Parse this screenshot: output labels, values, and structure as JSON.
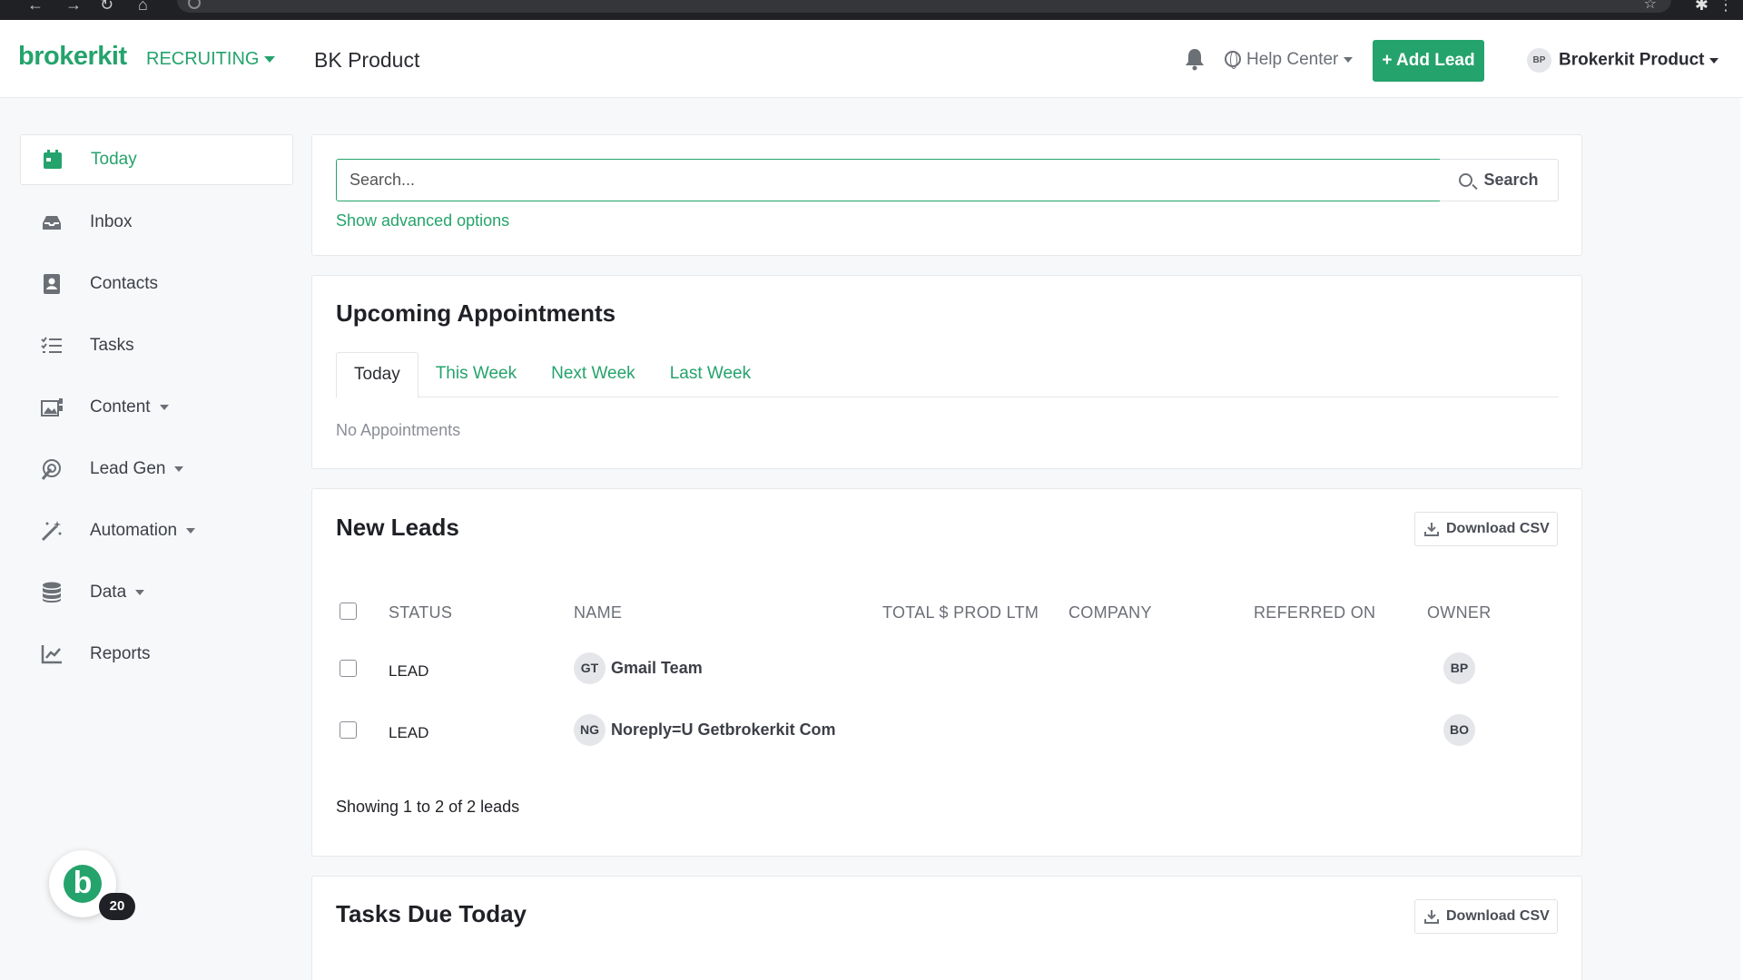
{
  "header": {
    "logo": "brokerkit",
    "module": "RECRUITING",
    "workspace": "BK Product",
    "help_center": "Help Center",
    "add_lead": "+ Add Lead",
    "user_initials": "BP",
    "user_name": "Brokerkit Product"
  },
  "sidebar": {
    "items": [
      {
        "label": "Today",
        "icon": "calendar-icon",
        "active": true
      },
      {
        "label": "Inbox",
        "icon": "inbox-icon"
      },
      {
        "label": "Contacts",
        "icon": "contacts-icon"
      },
      {
        "label": "Tasks",
        "icon": "tasks-icon"
      },
      {
        "label": "Content",
        "icon": "content-icon",
        "dropdown": true
      },
      {
        "label": "Lead Gen",
        "icon": "lead-gen-icon",
        "dropdown": true
      },
      {
        "label": "Automation",
        "icon": "magic-wand-icon",
        "dropdown": true
      },
      {
        "label": "Data",
        "icon": "database-icon",
        "dropdown": true
      },
      {
        "label": "Reports",
        "icon": "chart-line-icon"
      }
    ]
  },
  "search": {
    "placeholder": "Search...",
    "button": "Search",
    "advanced": "Show advanced options"
  },
  "appointments": {
    "title": "Upcoming Appointments",
    "tabs": [
      "Today",
      "This Week",
      "Next Week",
      "Last Week"
    ],
    "active_tab": "Today",
    "empty": "No Appointments"
  },
  "new_leads": {
    "title": "New Leads",
    "download": "Download CSV",
    "columns": [
      "STATUS",
      "NAME",
      "TOTAL $ PROD LTM",
      "COMPANY",
      "REFERRED ON",
      "OWNER"
    ],
    "rows": [
      {
        "status": "LEAD",
        "initials": "GT",
        "name": "Gmail Team",
        "owner": "BP"
      },
      {
        "status": "LEAD",
        "initials": "NG",
        "name": "Noreply=U Getbrokerkit Com",
        "owner": "BO"
      }
    ],
    "footer": "Showing 1 to 2 of 2 leads"
  },
  "tasks_due": {
    "title": "Tasks Due Today",
    "download": "Download CSV"
  },
  "chat": {
    "letter": "b",
    "badge": "20"
  },
  "colors": {
    "brand": "#25a36c",
    "text": "#2b2d33",
    "muted": "#6b6f76",
    "background": "#f7f8fa"
  }
}
